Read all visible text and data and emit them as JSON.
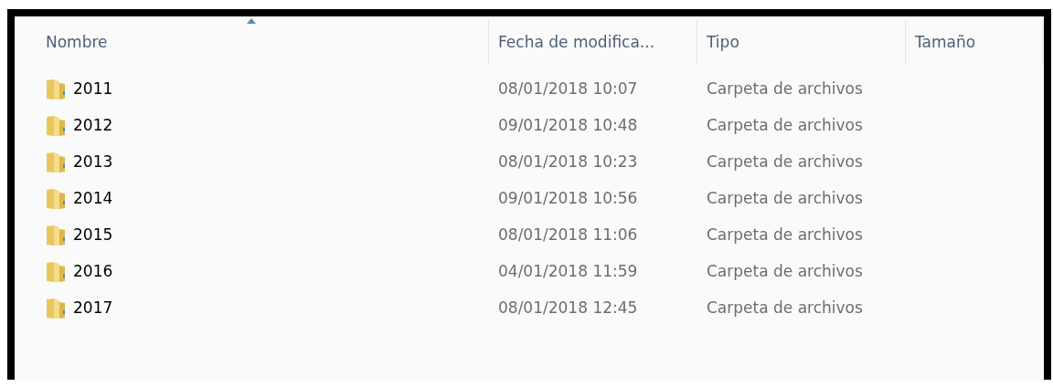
{
  "columns": [
    {
      "label": "Nombre",
      "sorted": true
    },
    {
      "label": "Fecha de modifica...",
      "sorted": false
    },
    {
      "label": "Tipo",
      "sorted": false
    },
    {
      "label": "Tamaño",
      "sorted": false
    }
  ],
  "rows": [
    {
      "name": "2011",
      "date": "08/01/2018 10:07",
      "type": "Carpeta de archivos"
    },
    {
      "name": "2012",
      "date": "09/01/2018 10:48",
      "type": "Carpeta de archivos"
    },
    {
      "name": "2013",
      "date": "08/01/2018 10:23",
      "type": "Carpeta de archivos"
    },
    {
      "name": "2014",
      "date": "09/01/2018 10:56",
      "type": "Carpeta de archivos"
    },
    {
      "name": "2015",
      "date": "08/01/2018 11:06",
      "type": "Carpeta de archivos"
    },
    {
      "name": "2016",
      "date": "04/01/2018 11:59",
      "type": "Carpeta de archivos"
    },
    {
      "name": "2017",
      "date": "08/01/2018 12:45",
      "type": "Carpeta de archivos"
    }
  ]
}
